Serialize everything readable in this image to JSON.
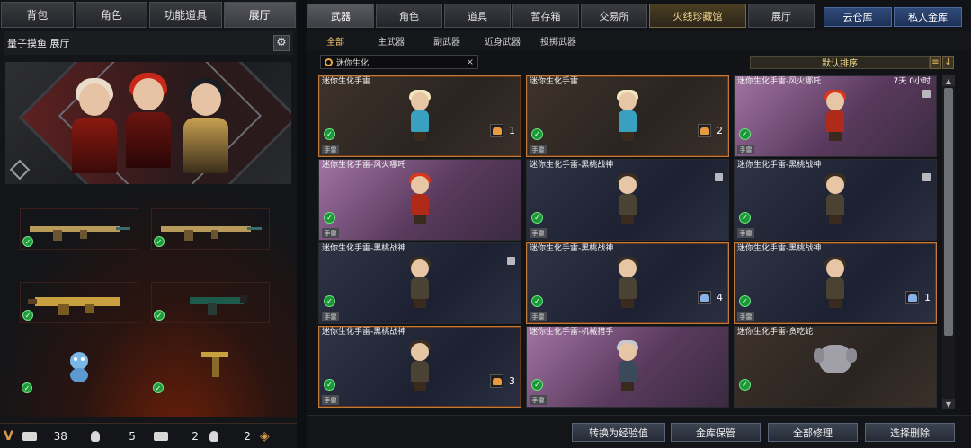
{
  "left_panel": {
    "tabs": [
      "背包",
      "角色",
      "功能道具",
      "展厅"
    ],
    "active_tab": "展厅",
    "header_title": "量子摸鱼 展厅",
    "stats": {
      "rifles": "38",
      "rifles_kills": "5",
      "pistols": "2",
      "pistols_kills": "2"
    }
  },
  "top_tabs": [
    "武器",
    "角色",
    "道具",
    "暂存箱",
    "交易所",
    "火线珍藏馆",
    "展厅"
  ],
  "active_top_tab": "武器",
  "corner_buttons": [
    "云仓库",
    "私人金库"
  ],
  "sub_tabs": [
    "全部",
    "主武器",
    "副武器",
    "近身武器",
    "投掷武器"
  ],
  "active_sub_tab": "全部",
  "search": {
    "value": "迷你生化",
    "clear_icon": "×"
  },
  "sort": {
    "label": "默认排序"
  },
  "items": [
    {
      "title": "迷你生化手雷",
      "time": "",
      "count": "1",
      "tag": "手雷",
      "bg": "brown",
      "selected": true,
      "figure": "blonde",
      "box": "orange",
      "lock": false
    },
    {
      "title": "迷你生化手雷",
      "time": "",
      "count": "2",
      "tag": "手雷",
      "bg": "brown",
      "selected": true,
      "figure": "blonde",
      "box": "orange",
      "lock": false
    },
    {
      "title": "迷你生化手雷-风火哪吒",
      "time": "7天 0小时",
      "count": "",
      "tag": "手雷",
      "bg": "pink",
      "selected": false,
      "figure": "redhair",
      "box": "",
      "lock": true
    },
    {
      "title": "迷你生化手雷-风火哪吒",
      "time": "",
      "count": "",
      "tag": "手雷",
      "bg": "pink",
      "selected": false,
      "figure": "redhair",
      "box": "",
      "lock": false
    },
    {
      "title": "迷你生化手雷-黑桃战神",
      "time": "",
      "count": "",
      "tag": "手雷",
      "bg": "navy",
      "selected": false,
      "figure": "soldier",
      "box": "",
      "lock": true
    },
    {
      "title": "迷你生化手雷-黑桃战神",
      "time": "",
      "count": "",
      "tag": "手雷",
      "bg": "navy",
      "selected": false,
      "figure": "soldier",
      "box": "",
      "lock": true
    },
    {
      "title": "迷你生化手雷-黑桃战神",
      "time": "",
      "count": "",
      "tag": "手雷",
      "bg": "navy",
      "selected": false,
      "figure": "soldier",
      "box": "",
      "lock": true
    },
    {
      "title": "迷你生化手雷-黑桃战神",
      "time": "",
      "count": "4",
      "tag": "手雷",
      "bg": "navy",
      "selected": true,
      "figure": "soldier",
      "box": "blue",
      "lock": false
    },
    {
      "title": "迷你生化手雷-黑桃战神",
      "time": "",
      "count": "1",
      "tag": "手雷",
      "bg": "navy",
      "selected": true,
      "figure": "soldier",
      "box": "blue",
      "lock": false
    },
    {
      "title": "迷你生化手雷-黑桃战神",
      "time": "",
      "count": "3",
      "tag": "手雷",
      "bg": "navy",
      "selected": true,
      "figure": "soldier",
      "box": "orange",
      "lock": false
    },
    {
      "title": "迷你生化手雷-机械猎手",
      "time": "",
      "count": "",
      "tag": "手雷",
      "bg": "pink",
      "selected": false,
      "figure": "hunter",
      "box": "",
      "lock": false
    },
    {
      "title": "迷你生化手雷-贪吃蛇",
      "time": "",
      "count": "",
      "tag": "",
      "bg": "brown",
      "selected": false,
      "figure": "elephant",
      "box": "",
      "lock": false
    }
  ],
  "bottom_buttons": [
    "转换为经验值",
    "金库保管",
    "全部修理",
    "选择删除"
  ],
  "colors": {
    "accent_gold": "#f2c86a",
    "check_green": "#1a9a36",
    "selected_border": "#c27a3a"
  },
  "icons": {
    "gear": "gear-icon",
    "search": "search-icon",
    "sort_list": "list-icon",
    "sort_dir": "arrow-down-icon"
  }
}
